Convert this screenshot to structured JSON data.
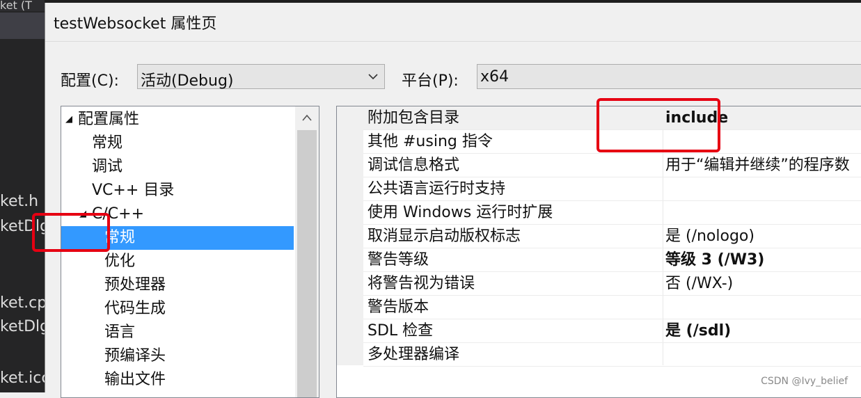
{
  "ide_background": {
    "tab_text": "ket (T",
    "files": [
      "ket.h",
      "ketDlg",
      "ket.cp",
      "ketDlg",
      "ket.icc"
    ]
  },
  "dialog": {
    "title": "testWebsocket 属性页",
    "configuration_label": "配置(C):",
    "configuration_value": "活动(Debug)",
    "platform_label": "平台(P):",
    "platform_value": "x64"
  },
  "tree": {
    "items": [
      {
        "label": "配置属性",
        "expanded": true
      },
      {
        "label": "常规"
      },
      {
        "label": "调试"
      },
      {
        "label": "VC++ 目录"
      },
      {
        "label": "C/C++",
        "expanded": true
      },
      {
        "label": "常规",
        "selected": true
      },
      {
        "label": "优化"
      },
      {
        "label": "预处理器"
      },
      {
        "label": "代码生成"
      },
      {
        "label": "语言"
      },
      {
        "label": "预编译头"
      },
      {
        "label": "输出文件"
      }
    ]
  },
  "properties": [
    {
      "name": "附加包含目录",
      "value": "include",
      "bold": true
    },
    {
      "name": "其他 #using 指令",
      "value": ""
    },
    {
      "name": "调试信息格式",
      "value": "用于“编辑并继续”的程序数"
    },
    {
      "name": "公共语言运行时支持",
      "value": ""
    },
    {
      "name": "使用 Windows 运行时扩展",
      "value": ""
    },
    {
      "name": "取消显示启动版权标志",
      "value": "是 (/nologo)"
    },
    {
      "name": "警告等级",
      "value": "等级 3 (/W3)",
      "bold": true
    },
    {
      "name": "将警告视为错误",
      "value": "否 (/WX-)"
    },
    {
      "name": "警告版本",
      "value": ""
    },
    {
      "name": "SDL 检查",
      "value": "是 (/sdl)",
      "bold": true
    },
    {
      "name": "多处理器编译",
      "value": ""
    }
  ],
  "colors": {
    "selection": "#3399ff",
    "annotation": "#e60012"
  },
  "watermark": "CSDN @Ivy_belief"
}
